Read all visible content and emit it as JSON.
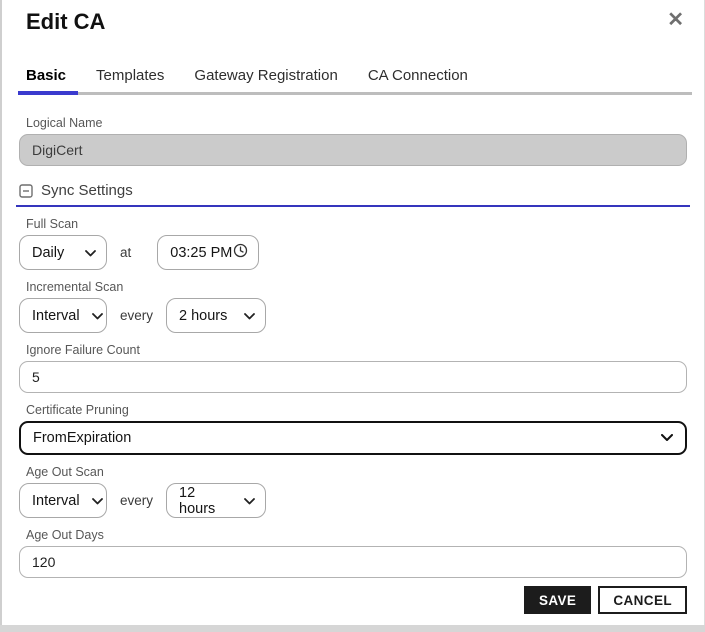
{
  "dialog": {
    "title": "Edit CA"
  },
  "icons": {
    "close": "✕",
    "collapse": "minus-square-icon",
    "chevron": "chevron-down-icon",
    "clock": "clock-icon"
  },
  "tabs": [
    {
      "label": "Basic",
      "active": true
    },
    {
      "label": "Templates",
      "active": false
    },
    {
      "label": "Gateway Registration",
      "active": false
    },
    {
      "label": "CA Connection",
      "active": false
    }
  ],
  "form": {
    "logical_name": {
      "label": "Logical Name",
      "value": "DigiCert",
      "disabled": true
    },
    "sync_settings": {
      "label": "Sync Settings",
      "expanded": true
    },
    "full_scan": {
      "label": "Full Scan",
      "mode": "Daily",
      "connector": "at",
      "time": "03:25 PM"
    },
    "incremental_scan": {
      "label": "Incremental Scan",
      "mode": "Interval",
      "connector": "every",
      "interval": "2 hours"
    },
    "ignore_failure_count": {
      "label": "Ignore Failure Count",
      "value": "5"
    },
    "certificate_pruning": {
      "label": "Certificate Pruning",
      "value": "FromExpiration"
    },
    "age_out_scan": {
      "label": "Age Out Scan",
      "mode": "Interval",
      "connector": "every",
      "interval": "12 hours"
    },
    "age_out_days": {
      "label": "Age Out Days",
      "value": "120"
    }
  },
  "footer": {
    "save_label": "SAVE",
    "cancel_label": "CANCEL"
  },
  "colors": {
    "accent_tab_underline": "#3a3ace",
    "section_divider": "#3535bd",
    "save_button_bg": "#1c1c1c",
    "disabled_input_bg": "#cbcbcb",
    "tab_bar_gray": "#bdbdbd"
  }
}
